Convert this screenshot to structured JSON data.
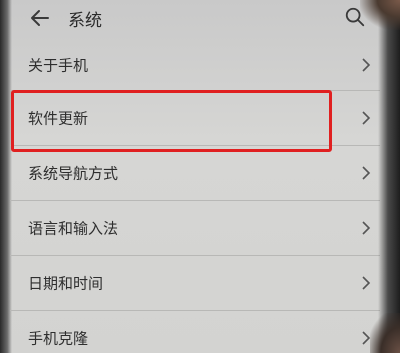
{
  "header": {
    "title": "系统",
    "back_icon": "arrow-left-icon",
    "search_icon": "search-icon"
  },
  "settings": {
    "items": [
      {
        "label": "关于手机"
      },
      {
        "label": "软件更新"
      },
      {
        "label": "系统导航方式"
      },
      {
        "label": "语言和输入法"
      },
      {
        "label": "日期和时间"
      },
      {
        "label": "手机克隆"
      }
    ],
    "highlighted_item": "软件更新",
    "highlight_color": "#e02020"
  }
}
